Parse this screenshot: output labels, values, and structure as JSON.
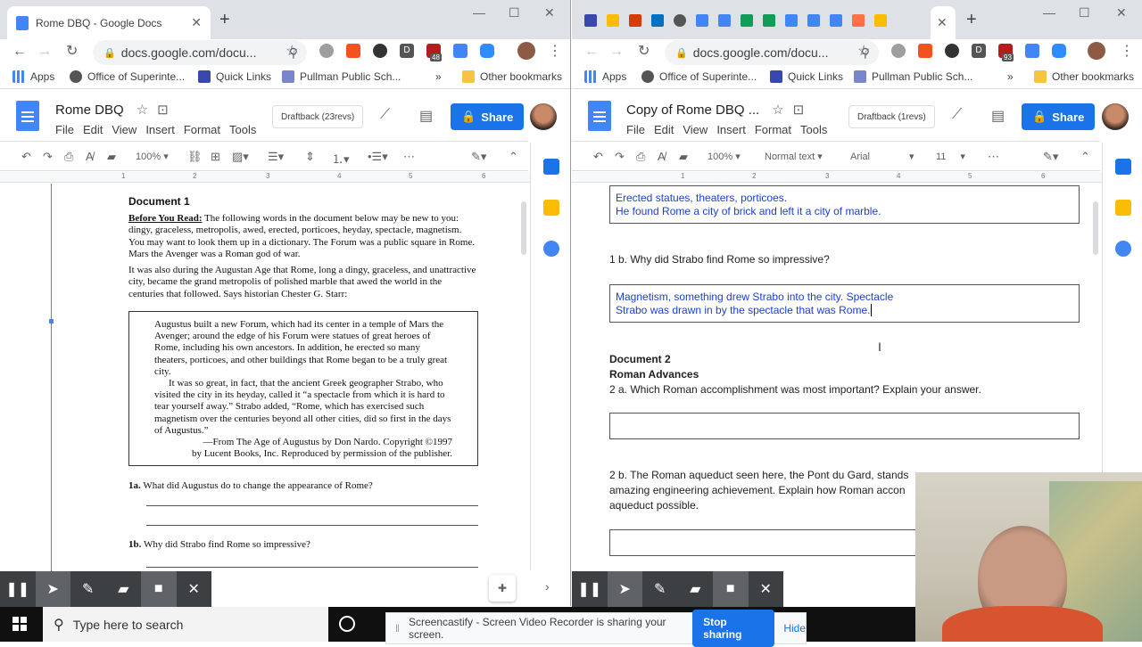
{
  "left": {
    "tab_title": "Rome DBQ - Google Docs",
    "url": "docs.google.com/docu...",
    "bookmarks": [
      "Apps",
      "Office of Superinte...",
      "Quick Links",
      "Pullman Public Sch...",
      "»",
      "Other bookmarks"
    ],
    "doc_title": "Rome DBQ",
    "menus": [
      "File",
      "Edit",
      "View",
      "Insert",
      "Format",
      "Tools"
    ],
    "draftback": "Draftback (23revs)",
    "share": "Share",
    "zoom": "100%",
    "ext_badge": "48",
    "ruler_numbers": [
      "1",
      "2",
      "3",
      "4",
      "5",
      "6"
    ],
    "scan": {
      "heading": "Document 1",
      "before_label": "Before You Read:",
      "p1": " The following words in the document below may be new to you: dingy, graceless, metropolis, awed, erected, porticoes, heyday, spectacle, magnetism. You may want to look them up in a dictionary. The Forum was a public square in Rome. Mars the Avenger was a Roman god of war.",
      "p2": "It was also during the Augustan Age that Rome, long a dingy, graceless, and unattractive city, became the grand metropolis of polished marble that awed the world in the centuries that followed. Says historian Chester G. Starr:",
      "quote1": "Augustus built a new Forum, which had its center in a temple of Mars the Avenger; around the edge of his Forum were statues of great heroes of Rome, including his own ancestors. In addition, he erected so many theaters, porticoes, and other buildings that Rome began to be a truly great city.",
      "quote2": "It was so great, in fact, that the ancient Greek geographer Strabo, who visited the city in its heyday, called it “a spectacle from which it is hard to tear yourself away.” Strabo added, “Rome, which has exercised such magnetism over the centuries beyond all other cities, did so first in the days of Augustus.”",
      "citation1": "—From The Age of Augustus by Don Nardo. Copyright ©1997",
      "citation2": "by Lucent Books, Inc. Reproduced by permission of the publisher.",
      "q1a_num": "1a.",
      "q1a": "What did Augustus do to change the appearance of Rome?",
      "q1b_num": "1b.",
      "q1b": "Why did Strabo find Rome so impressive?"
    }
  },
  "right": {
    "url": "docs.google.com/docu...",
    "bookmarks": [
      "Apps",
      "Office of Superinte...",
      "Quick Links",
      "Pullman Public Sch...",
      "»",
      "Other bookmarks"
    ],
    "doc_title": "Copy of Rome DBQ ...",
    "menus": [
      "File",
      "Edit",
      "View",
      "Insert",
      "Format",
      "Tools"
    ],
    "draftback": "Draftback (1revs)",
    "share": "Share",
    "zoom": "100%",
    "style": "Normal text",
    "font": "Arial",
    "size": "11",
    "ext_badge": "93",
    "ruler_numbers": [
      "1",
      "2",
      "3",
      "4",
      "5",
      "6"
    ],
    "answer1a": [
      "Erected statues, theaters, porticoes.",
      "He found Rome a city of brick and left it a city of marble."
    ],
    "q1b": "1 b. Why did Strabo find Rome so impressive?",
    "answer1b": [
      "Magnetism, something drew Strabo into the city. Spectacle",
      "Strabo was drawn in by the spectacle that was Rome."
    ],
    "doc2_title": "Document 2",
    "doc2_sub": "Roman Advances",
    "q2a": "2 a. Which Roman accomplishment was most important? Explain your answer.",
    "q2b": "2 b. The Roman aqueduct seen here, the Pont du Gard, stands",
    "q2b_l2": "amazing engineering achievement.  Explain how Roman accon",
    "q2b_l3": "aqueduct possible."
  },
  "taskbar": {
    "search_placeholder": "Type here to search",
    "share_notice": "Screencastify - Screen Video Recorder is sharing your screen.",
    "stop": "Stop sharing",
    "hide": "Hide"
  }
}
